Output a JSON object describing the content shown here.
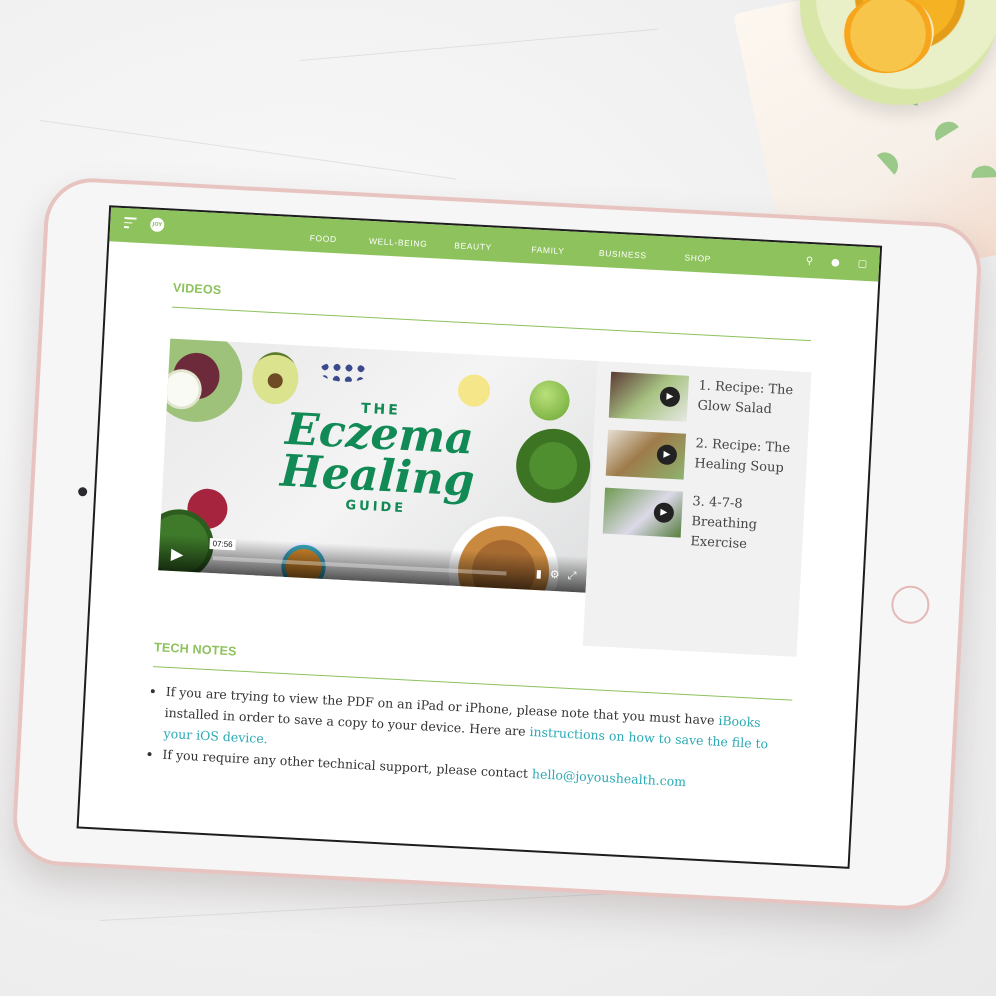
{
  "nav": {
    "links": [
      "FOOD",
      "WELL-BEING",
      "BEAUTY",
      "FAMILY",
      "BUSINESS",
      "SHOP"
    ]
  },
  "videos_section": {
    "title": "VIDEOS"
  },
  "video": {
    "title_the": "THE",
    "title_main_1": "Eczema",
    "title_main_2": "Healing",
    "title_guide": "GUIDE",
    "timecode": "07:56"
  },
  "playlist": [
    {
      "label": "1. Recipe: The Glow Salad"
    },
    {
      "label": "2. Recipe: The Healing Soup"
    },
    {
      "label": "3. 4-7-8 Breathing Exercise"
    }
  ],
  "tech_notes": {
    "title": "TECH NOTES",
    "item1_pre": "If you are trying to view the PDF on an iPad or iPhone, please note that you must have ",
    "item1_link1": "iBooks",
    "item1_mid": " installed in order to save a copy to your device. Here are ",
    "item1_link2": "instructions on how to save the file to your iOS device.",
    "item2_pre": "If you require any other technical support, please contact ",
    "item2_link": "hello@joyoushealth.com"
  },
  "colors": {
    "brand_green": "#8dc25c",
    "title_green": "#128a55",
    "link_teal": "#2ba9b4",
    "frame_rose": "#e8c4c0"
  },
  "icons": [
    "menu-icon",
    "search-icon",
    "user-icon",
    "cart-icon",
    "play-icon",
    "volume-icon",
    "gear-icon",
    "fullscreen-icon"
  ]
}
